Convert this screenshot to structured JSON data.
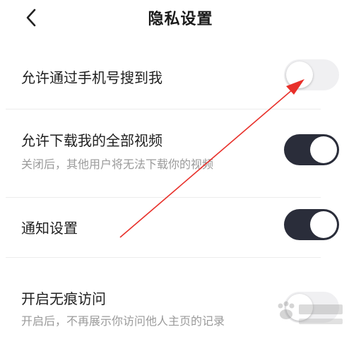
{
  "header": {
    "title": "隐私设置",
    "back_icon": "chevron-left-icon"
  },
  "settings": [
    {
      "label": "允许通过手机号搜到我",
      "sub": "",
      "enabled": false
    },
    {
      "label": "允许下载我的全部视频",
      "sub": "关闭后，其他用户将无法下载你的视频",
      "enabled": true
    },
    {
      "label": "通知设置",
      "sub": "",
      "enabled": true
    },
    {
      "label": "开启无痕访问",
      "sub": "开启后，不再展示你访问他人主页的记录",
      "enabled": false
    }
  ],
  "annotation": {
    "color": "#e8302a"
  },
  "colors": {
    "toggle_on": "#2a2d3a",
    "toggle_off": "#f0f0f2",
    "subtext": "#9a9a9a"
  },
  "watermark": {
    "text": "Baidu经验",
    "subtext": "jingyan.baidu.com"
  }
}
